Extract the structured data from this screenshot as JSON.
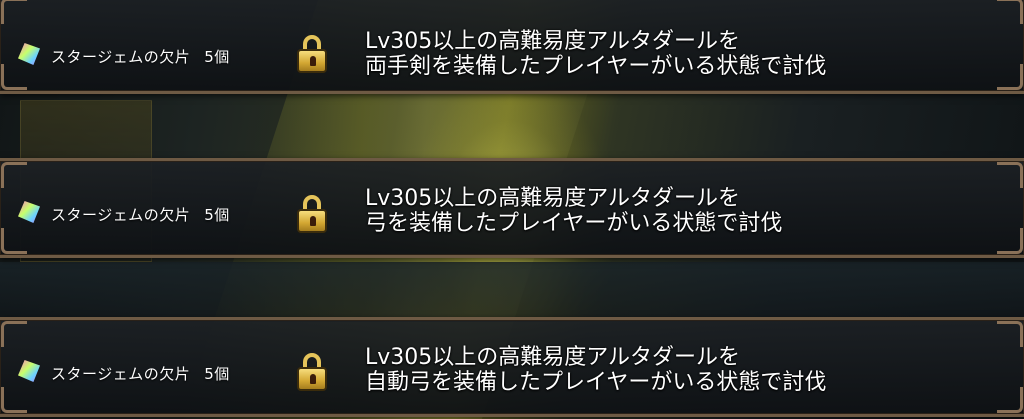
{
  "missions": [
    {
      "reward_name": "スタージェムの欠片",
      "reward_count": "5個",
      "reward_icon": "star-gem-fragment-icon",
      "locked": true,
      "desc_line1": "Lv305以上の高難易度アルタダールを",
      "desc_line2": "両手剣を装備したプレイヤーがいる状態で討伐"
    },
    {
      "reward_name": "スタージェムの欠片",
      "reward_count": "5個",
      "reward_icon": "star-gem-fragment-icon",
      "locked": true,
      "desc_line1": "Lv305以上の高難易度アルタダールを",
      "desc_line2": "弓を装備したプレイヤーがいる状態で討伐"
    },
    {
      "reward_name": "スタージェムの欠片",
      "reward_count": "5個",
      "reward_icon": "star-gem-fragment-icon",
      "locked": true,
      "desc_line1": "Lv305以上の高難易度アルタダールを",
      "desc_line2": "自動弓を装備したプレイヤーがいる状態で討伐"
    }
  ],
  "colors": {
    "frame": "#6e5a44",
    "lock_gold": "#e5c45a",
    "text": "#ffffff"
  }
}
